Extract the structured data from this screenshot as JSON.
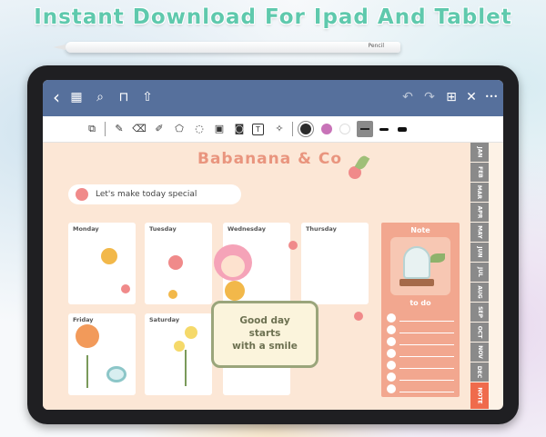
{
  "headline": "Instant Download For Ipad And Tablet",
  "pencil": {
    "brand": "Pencil"
  },
  "nav": {
    "back_icon": "‹",
    "grid_icon": "▦",
    "search_icon": "⌕",
    "bookmark_icon": "⊓",
    "share_icon": "⇧",
    "undo_icon": "↶",
    "redo_icon": "↷",
    "add_page_icon": "⊞",
    "close_icon": "✕",
    "more_icon": "•••"
  },
  "toolbar": {
    "icons": [
      "⧉",
      "✎",
      "⌫",
      "✐",
      "⬠",
      "◌",
      "▣",
      "◙",
      "T",
      "✧"
    ],
    "colors": [
      "#2b2b2b",
      "#c873b8",
      "#ffffff"
    ]
  },
  "planner": {
    "brand": "Babanana & Co",
    "banner": "Let's make today special",
    "days": [
      "Monday",
      "Tuesday",
      "Wednesday",
      "Thursday",
      "Friday",
      "Saturday"
    ],
    "quote": [
      "Good day",
      "starts",
      "with a smile"
    ],
    "note_title": "Note",
    "todo_title": "to do"
  },
  "months": [
    "JAN",
    "FEB",
    "MAR",
    "APR",
    "MAY",
    "JUN",
    "JUL",
    "AUG",
    "SEP",
    "OCT",
    "NOV",
    "DEC",
    "NOTE"
  ]
}
